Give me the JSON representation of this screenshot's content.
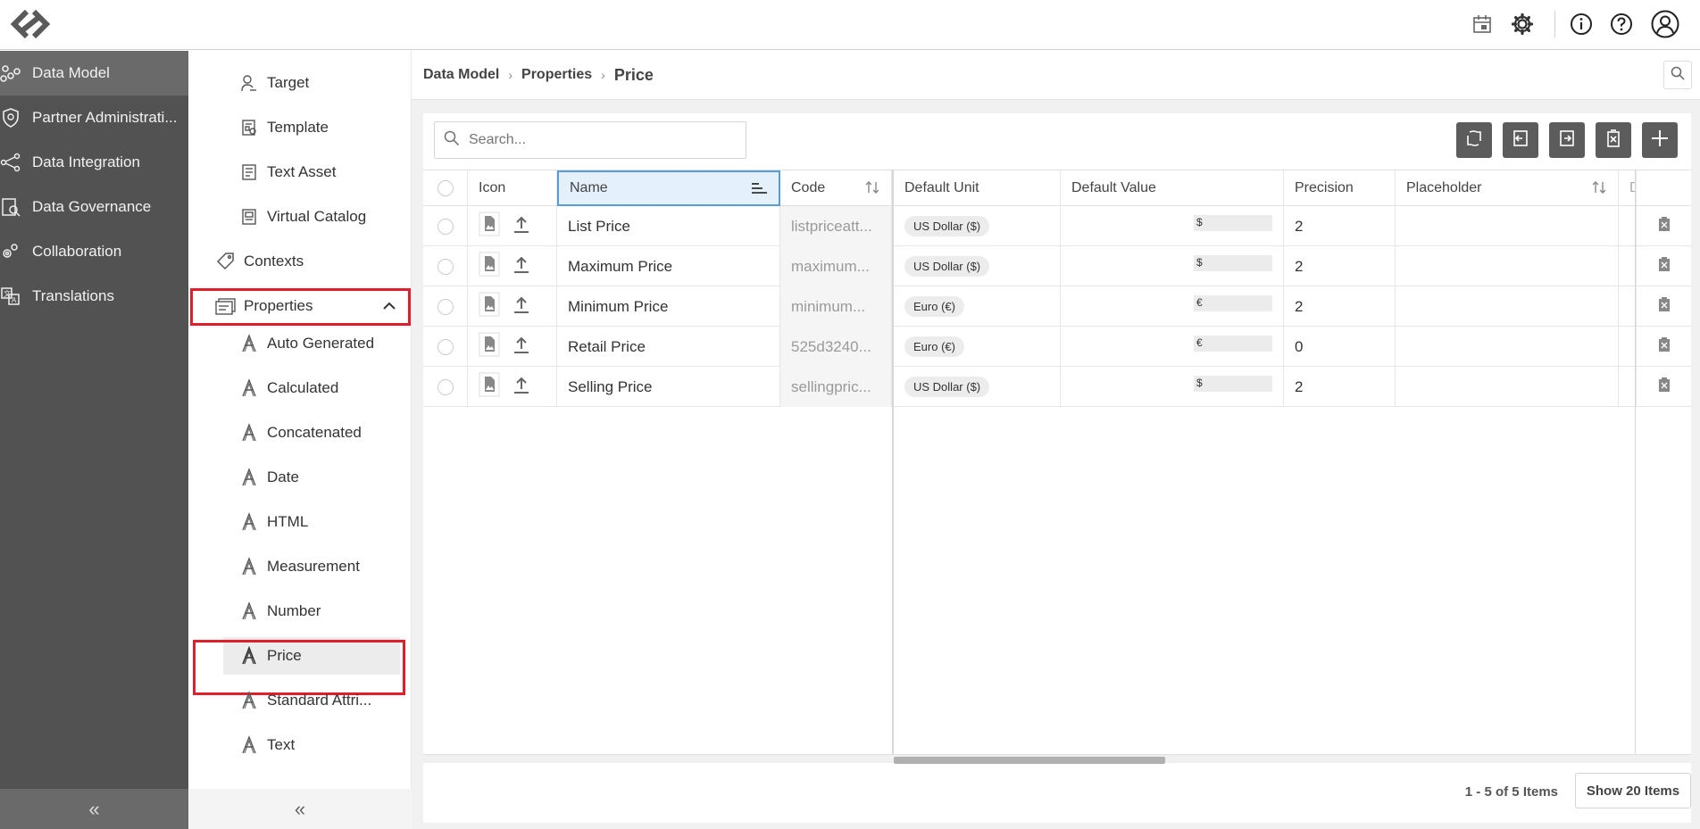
{
  "topbar": {
    "icons": [
      "logo-icon",
      "calendar-icon",
      "gear-icon",
      "info-icon",
      "help-icon",
      "user-icon"
    ]
  },
  "leftnav": {
    "items": [
      {
        "label": "Data Model",
        "icon": "data-model-icon",
        "active": true
      },
      {
        "label": "Partner Administrati...",
        "icon": "shield-icon",
        "active": false
      },
      {
        "label": "Data Integration",
        "icon": "integration-icon",
        "active": false
      },
      {
        "label": "Data Governance",
        "icon": "governance-icon",
        "active": false
      },
      {
        "label": "Collaboration",
        "icon": "collaboration-icon",
        "active": false
      },
      {
        "label": "Translations",
        "icon": "translations-icon",
        "active": false
      }
    ],
    "collapse": "«"
  },
  "subnav": {
    "items_top": [
      {
        "label": "Target",
        "icon": "target-icon"
      },
      {
        "label": "Template",
        "icon": "template-icon"
      },
      {
        "label": "Text Asset",
        "icon": "text-asset-icon"
      },
      {
        "label": "Virtual Catalog",
        "icon": "virtual-catalog-icon"
      }
    ],
    "contexts": "Contexts",
    "properties": "Properties",
    "property_types": [
      "Auto Generated",
      "Calculated",
      "Concatenated",
      "Date",
      "HTML",
      "Measurement",
      "Number",
      "Price",
      "Standard Attri...",
      "Text"
    ],
    "selected": "Price",
    "collapse": "«"
  },
  "breadcrumb": {
    "items": [
      "Data Model",
      "Properties"
    ],
    "current": "Price",
    "sep": "›"
  },
  "search": {
    "placeholder": "Search..."
  },
  "table": {
    "headers": {
      "icon": "Icon",
      "name": "Name",
      "code": "Code",
      "default_unit": "Default Unit",
      "default_value": "Default Value",
      "precision": "Precision",
      "placeholder": "Placeholder",
      "d": "D"
    },
    "rows": [
      {
        "name": "List Price",
        "code": "listpriceatt...",
        "unit": "US Dollar ($)",
        "value": "$",
        "precision": "2",
        "placeholder": ""
      },
      {
        "name": "Maximum Price",
        "code": "maximum...",
        "unit": "US Dollar ($)",
        "value": "$",
        "precision": "2",
        "placeholder": ""
      },
      {
        "name": "Minimum Price",
        "code": "minimum...",
        "unit": "Euro (€)",
        "value": "€",
        "precision": "2",
        "placeholder": ""
      },
      {
        "name": "Retail Price",
        "code": "525d3240...",
        "unit": "Euro (€)",
        "value": "€",
        "precision": "0",
        "placeholder": ""
      },
      {
        "name": "Selling Price",
        "code": "sellingpric...",
        "unit": "US Dollar ($)",
        "value": "$",
        "precision": "2",
        "placeholder": ""
      }
    ]
  },
  "footer": {
    "count": "1 - 5 of 5 Items",
    "show": "Show 20 Items"
  },
  "colors": {
    "nav_bg": "#525252",
    "nav_active": "#6a6a6a",
    "highlight": "#e01e2c",
    "toolbar_btn": "#5c5c5c",
    "name_header": "#e4f0fb"
  }
}
